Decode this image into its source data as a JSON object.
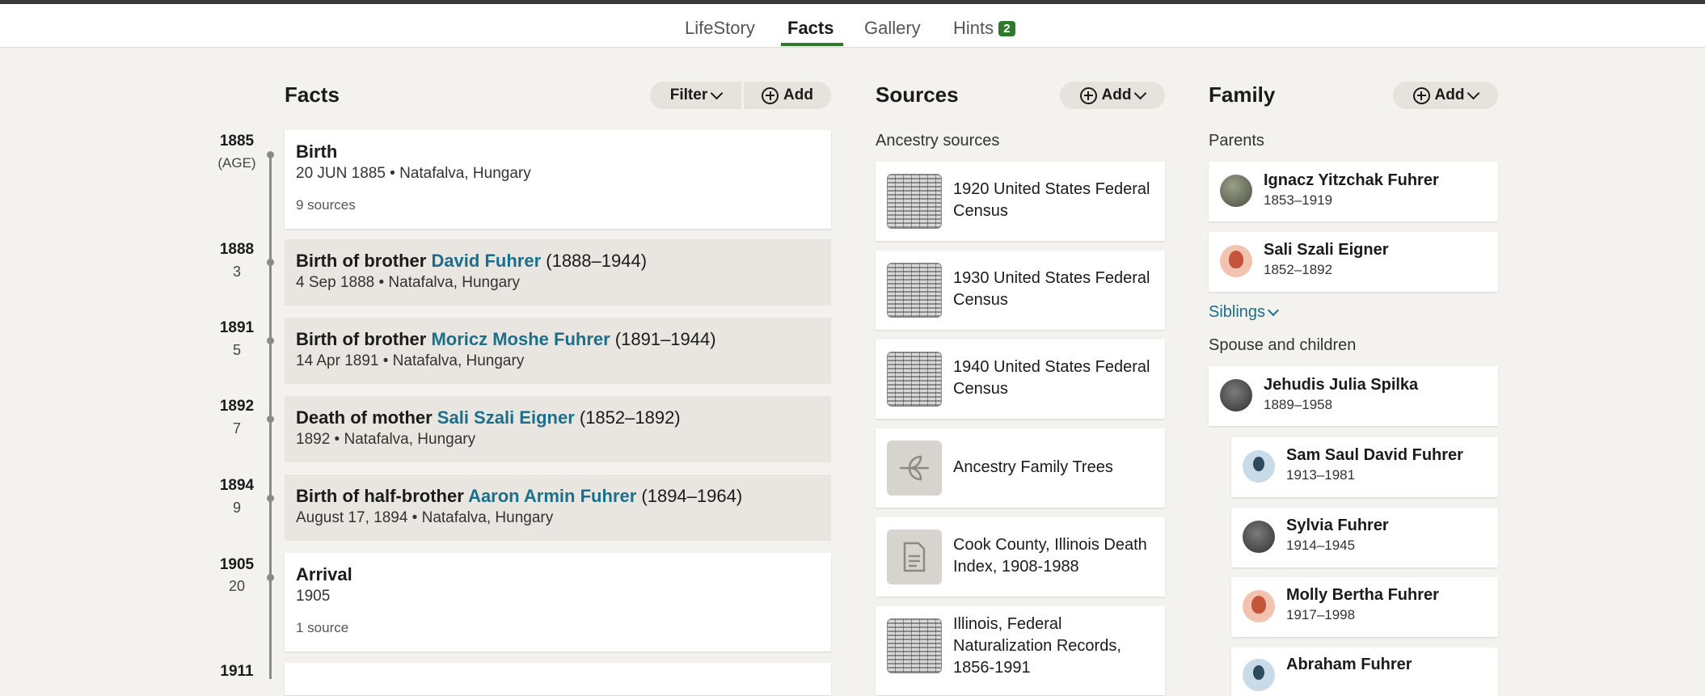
{
  "tabs": [
    {
      "label": "LifeStory"
    },
    {
      "label": "Facts"
    },
    {
      "label": "Gallery"
    },
    {
      "label": "Hints",
      "badge": "2"
    }
  ],
  "facts": {
    "heading": "Facts",
    "filter_label": "Filter",
    "add_label": "Add",
    "timeline": [
      {
        "year": "1885",
        "age": "(AGE)"
      },
      {
        "year": "1888",
        "age": "3"
      },
      {
        "year": "1891",
        "age": "5"
      },
      {
        "year": "1892",
        "age": "7"
      },
      {
        "year": "1894",
        "age": "9"
      },
      {
        "year": "1905",
        "age": "20"
      },
      {
        "year": "1911",
        "age": ""
      }
    ],
    "items": [
      {
        "title": "Birth",
        "sub": "20 JUN 1885 • Natafalva, Hungary",
        "sources": "9 sources"
      },
      {
        "prefix": "Birth of brother ",
        "link": "David Fuhrer",
        "suffix": " (1888–1944)",
        "sub": "4 Sep 1888 • Natafalva, Hungary"
      },
      {
        "prefix": "Birth of brother ",
        "link": "Moricz Moshe Fuhrer",
        "suffix": " (1891–1944)",
        "sub": "14 Apr 1891 • Natafalva, Hungary"
      },
      {
        "prefix": "Death of mother ",
        "link": "Sali Szali Eigner",
        "suffix": " (1852–1892)",
        "sub": "1892 • Natafalva, Hungary"
      },
      {
        "prefix": "Birth of half-brother ",
        "link": "Aaron Armin Fuhrer",
        "suffix": " (1894–1964)",
        "sub": "August 17, 1894 • Natafalva, Hungary"
      },
      {
        "title": "Arrival",
        "sub": "1905",
        "sources": "1 source"
      }
    ]
  },
  "sources": {
    "heading": "Sources",
    "add_label": "Add",
    "section_label": "Ancestry sources",
    "items": [
      {
        "title": "1920 United States Federal Census",
        "thumb": "census-record"
      },
      {
        "title": "1930 United States Federal Census",
        "thumb": "census-record"
      },
      {
        "title": "1940 United States Federal Census",
        "thumb": "census-record"
      },
      {
        "title": "Ancestry Family Trees",
        "thumb": "leaf-icon"
      },
      {
        "title": "Cook County, Illinois Death Index, 1908-1988",
        "thumb": "document-icon"
      },
      {
        "title": "Illinois, Federal Naturalization Records, 1856-1991",
        "thumb": "naturalization-record"
      }
    ]
  },
  "family": {
    "heading": "Family",
    "add_label": "Add",
    "parents_label": "Parents",
    "parents": [
      {
        "name": "Ignacz Yitzchak Fuhrer",
        "dates": "1853–1919"
      },
      {
        "name": "Sali Szali Eigner",
        "dates": "1852–1892"
      }
    ],
    "siblings_label": "Siblings",
    "spouse_label": "Spouse and children",
    "spouse": {
      "name": "Jehudis Julia Spilka",
      "dates": "1889–1958"
    },
    "children": [
      {
        "name": "Sam Saul David Fuhrer",
        "dates": "1913–1981"
      },
      {
        "name": "Sylvia Fuhrer",
        "dates": "1914–1945"
      },
      {
        "name": "Molly Bertha Fuhrer",
        "dates": "1917–1998"
      },
      {
        "name": "Abraham Fuhrer",
        "dates": ""
      }
    ]
  }
}
